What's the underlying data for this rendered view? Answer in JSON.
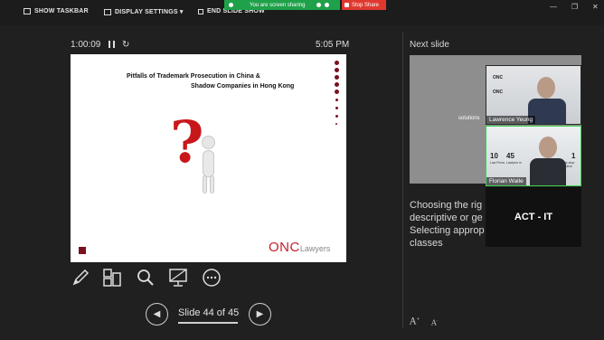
{
  "toolbar": {
    "show_taskbar": "SHOW TASKBAR",
    "display_settings": "DISPLAY SETTINGS ▾",
    "end_slide_show": "END SLIDE SHOW"
  },
  "sharing": {
    "status": "You are screen sharing",
    "stop": "Stop Share",
    "status_color": "#1fa14a",
    "stop_color": "#e0382f"
  },
  "presenter": {
    "elapsed": "1:00:09",
    "clock": "5:05 PM"
  },
  "slide": {
    "title_line1": "Pitfalls of Trademark Prosecution in China &",
    "title_line2": "Shadow Companies in Hong Kong",
    "logo_main": "ONC",
    "logo_sub": "Lawyers"
  },
  "navigation": {
    "slide_counter": "Slide 44 of 45"
  },
  "next_slide": {
    "label": "Next slide",
    "thumb_text": "solutions"
  },
  "notes": {
    "lines": [
      "Choosing the rig",
      "descriptive or ge",
      "Selecting approp",
      "classes"
    ]
  },
  "participants": [
    {
      "name": "Lawrence Yeung",
      "banner": "ONC"
    },
    {
      "name": "Florian Walle",
      "stats": [
        {
          "value": "10",
          "label": "Law Firms"
        },
        {
          "value": "45",
          "label": "Lawyers in"
        },
        {
          "value": "1",
          "label": "One-stop solution"
        }
      ]
    },
    {
      "name": "ACT - IT"
    }
  ],
  "icons": [
    "monitor-icon",
    "display-settings-icon",
    "end-show-icon",
    "pen-icon",
    "slides-grid-icon",
    "zoom-icon",
    "screen-icon",
    "more-icon",
    "prev-icon",
    "next-icon"
  ]
}
